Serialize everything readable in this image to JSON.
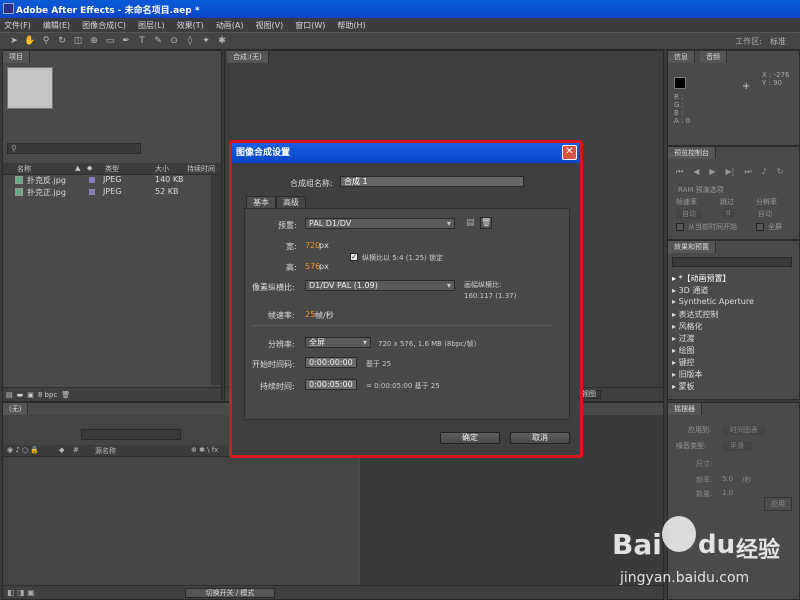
{
  "window": {
    "title": "Adobe After Effects - 未命名项目.aep *"
  },
  "menu": [
    "文件(F)",
    "编辑(E)",
    "图像合成(C)",
    "图层(L)",
    "效果(T)",
    "动画(A)",
    "视图(V)",
    "窗口(W)",
    "帮助(H)"
  ],
  "toolbar": {
    "workspace_label": "工作区:",
    "workspace_value": "标准"
  },
  "project": {
    "tab": "项目",
    "search_icon": "search-icon",
    "columns": {
      "name": "名称",
      "type": "类型",
      "size": "大小",
      "duration": "持续时间"
    },
    "files": [
      {
        "name": "扑克反.jpg",
        "type": "JPEG",
        "size": "140 KB"
      },
      {
        "name": "扑克正.jpg",
        "type": "JPEG",
        "size": "52 KB"
      }
    ],
    "bpc": "8 bpc"
  },
  "comp": {
    "tab": "合成:(无)",
    "view": "视图"
  },
  "info": {
    "tabs": [
      "信息",
      "音频"
    ],
    "x": "X : -276",
    "y": "Y : 90",
    "r": "R :",
    "g": "G :",
    "b": "B :",
    "a": "A : 0"
  },
  "preview": {
    "tab": "预览控制台",
    "ram_option": "RAM 预演选项",
    "labels": [
      "帧速率",
      "跳过",
      "分辨率"
    ],
    "values": [
      "自动",
      "0",
      "自动"
    ],
    "from_current": "从当前时间开始",
    "full_screen": "全屏"
  },
  "effects": {
    "tab": "效果和预置",
    "items": [
      "*【动画预置】",
      "3D 通道",
      "Synthetic Aperture",
      "表达式控制",
      "风格化",
      "过渡",
      "绘图",
      "键控",
      "旧版本",
      "蒙板"
    ]
  },
  "paragraph": {
    "tab": "摇摆器",
    "apply_to_label": "应用到:",
    "apply_to_value": "时间图表",
    "noise_label": "噪音类型:",
    "noise_value": "平滑",
    "dimension_label": "尺寸:",
    "freq_label": "频率:",
    "freq_value": "5.0",
    "freq_unit": "/秒",
    "mag_label": "数量:",
    "mag_value": "1.0",
    "apply_btn": "应用"
  },
  "timeline": {
    "tab": "(无)",
    "source_col": "源名称",
    "switch_btn": "切换开关 / 模式"
  },
  "dialog": {
    "title": "图像合成设置",
    "name_label": "合成组名称:",
    "name_value": "合成 1",
    "tabs": [
      "基本",
      "高级"
    ],
    "preset_label": "预置:",
    "preset_value": "PAL D1/DV",
    "width_label": "宽:",
    "width_value": "720",
    "height_label": "高:",
    "height_value": "576",
    "px": "px",
    "lock_text": "纵横比以 5:4 (1.25) 锁定",
    "par_label": "像素纵横比:",
    "par_value": "D1/DV PAL (1.09)",
    "frame_aspect_label": "画幅纵横比:",
    "frame_aspect_value": "160:117 (1.37)",
    "fps_label": "帧速率:",
    "fps_value": "25",
    "fps_unit": "帧/秒",
    "res_label": "分辨率:",
    "res_value": "全屏",
    "res_info": "720 x 576, 1.6 MB (8bpc/帧)",
    "start_label": "开始时间码:",
    "start_value": "0:00:00:00",
    "start_base": "基于 25",
    "dur_label": "持续时间:",
    "dur_value": "0:00:05:00",
    "dur_info": "= 0:00:05:00  基于 25",
    "ok": "确定",
    "cancel": "取消"
  },
  "watermark": {
    "brand": "Bai",
    "brand2": "du",
    "cn": "经验",
    "url": "jingyan.baidu.com"
  },
  "colors": {
    "title_bar": "#0a46c4",
    "dialog_border": "#d7151f",
    "orange_value": "#e99a2b"
  }
}
